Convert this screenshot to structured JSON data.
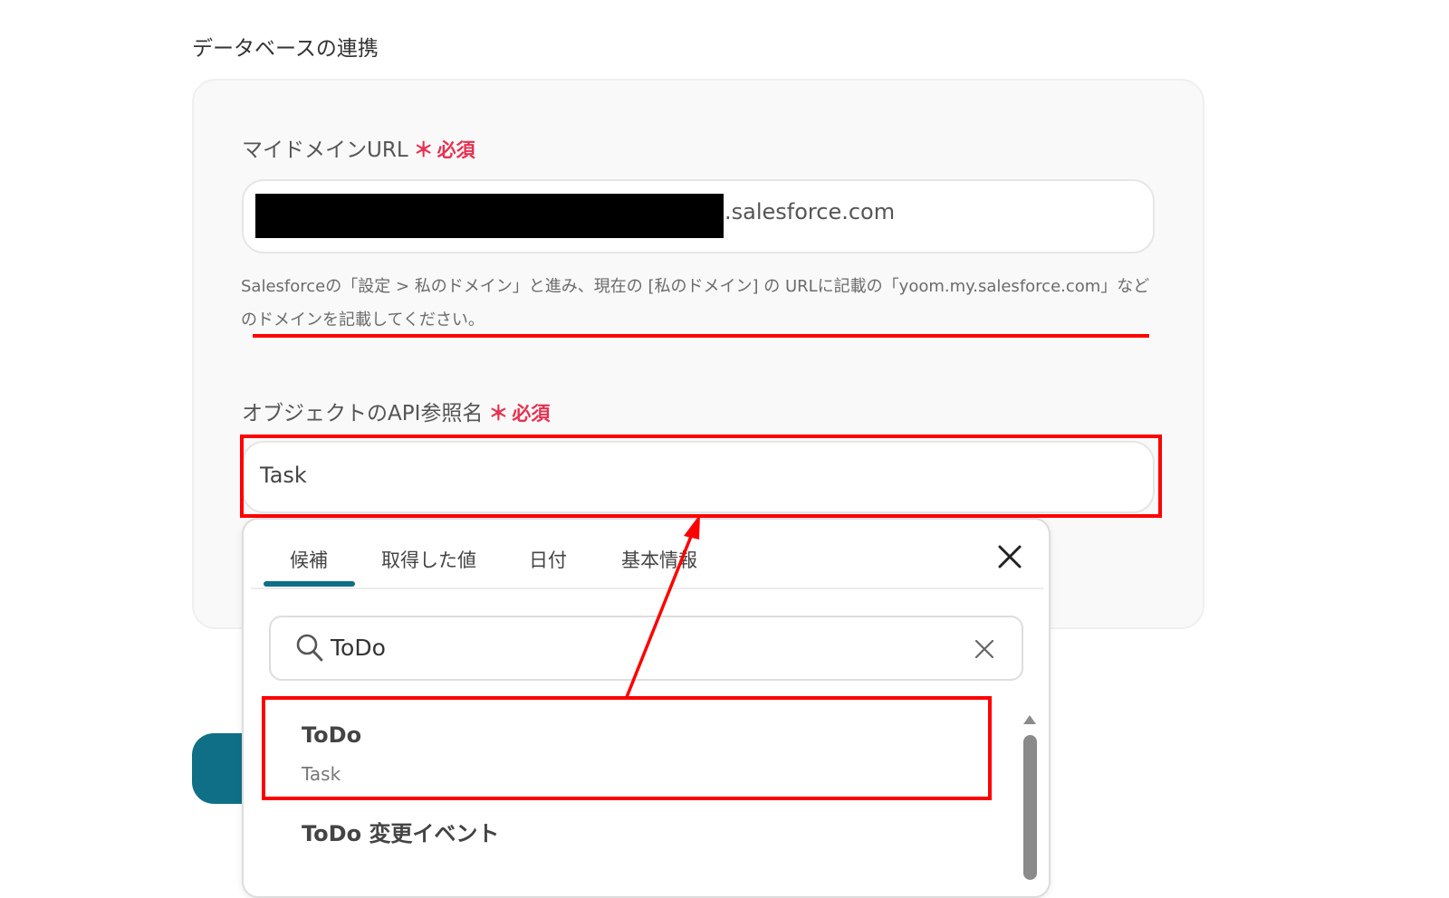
{
  "section_title": "データベースの連携",
  "domain_field": {
    "label": "マイドメインURL",
    "required_mark": "＊",
    "required_text": "必須",
    "value_suffix": ".salesforce.com",
    "help_text": "Salesforceの「設定 > 私のドメイン」と進み、現在の [私のドメイン] の URLに記載の「yoom.my.salesforce.com」などのドメインを記載してください。"
  },
  "object_field": {
    "label": "オブジェクトのAPI参照名",
    "required_mark": "＊",
    "required_text": "必須",
    "value": "Task"
  },
  "dropdown": {
    "tabs": [
      {
        "label": "候補",
        "active": true
      },
      {
        "label": "取得した値",
        "active": false
      },
      {
        "label": "日付",
        "active": false
      },
      {
        "label": "基本情報",
        "active": false
      }
    ],
    "search_value": "ToDo",
    "results": [
      {
        "title": "ToDo",
        "subtitle": "Task",
        "highlighted": true
      },
      {
        "title": "ToDo 変更イベント",
        "subtitle": ""
      }
    ]
  },
  "colors": {
    "accent": "#0f6f86",
    "required": "#e8304f",
    "annotation": "#ff0000"
  },
  "icons": [
    "search-icon",
    "close-icon",
    "clear-icon"
  ]
}
